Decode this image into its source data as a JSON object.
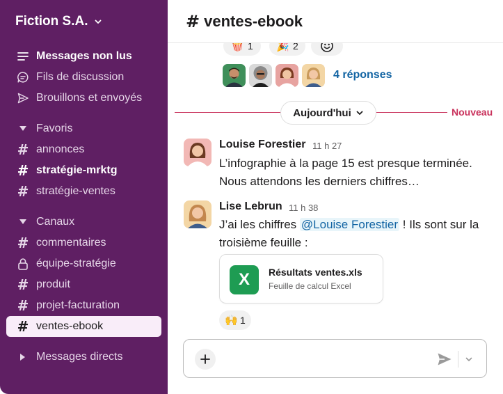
{
  "workspace": {
    "name": "Fiction S.A."
  },
  "sidebar": {
    "top_items": [
      {
        "label": "Messages non lus",
        "icon": "unread-icon"
      },
      {
        "label": "Fils de discussion",
        "icon": "threads-icon"
      },
      {
        "label": "Brouillons et envoyés",
        "icon": "send-icon"
      }
    ],
    "favorites": {
      "title": "Favoris",
      "items": [
        "annonces",
        "stratégie-mrktg",
        "stratégie-ventes"
      ]
    },
    "channels": {
      "title": "Canaux",
      "items": [
        "commentaires",
        "équipe-stratégie",
        "produit",
        "projet-facturation",
        "ventes-ebook"
      ]
    },
    "direct_messages": {
      "title": "Messages directs"
    }
  },
  "channel": {
    "name": "ventes-ebook"
  },
  "thread_reactions": [
    {
      "emoji": "🍿",
      "count": "1"
    },
    {
      "emoji": "🎉",
      "count": "2"
    }
  ],
  "thread": {
    "replies_label": "4 réponses"
  },
  "divider": {
    "day_label": "Aujourd'hui",
    "new_label": "Nouveau"
  },
  "messages": [
    {
      "author": "Louise Forestier",
      "time": "11 h 27",
      "text_line1": "L’infographie à la page 15 est presque terminée.",
      "text_line2": "Nous attendons les derniers chiffres…"
    },
    {
      "author": "Lise Lebrun",
      "time": "11 h 38",
      "text_prefix": "J’ai les chiffres ",
      "mention": "@Louise Forestier",
      "text_suffix": " ! Ils sont sur la",
      "text_line2": "troisième feuille :",
      "attachment": {
        "name": "Résultats ventes.xls",
        "type": "Feuille de calcul Excel",
        "icon_letter": "X"
      },
      "reaction": {
        "emoji": "🙌",
        "count": "1"
      }
    }
  ],
  "colors": {
    "sidebar_bg": "#5f1f63",
    "active_item_bg": "#f9edf9",
    "link": "#1264a3",
    "new_divider": "#c9325c",
    "excel_green": "#1e9c53"
  }
}
